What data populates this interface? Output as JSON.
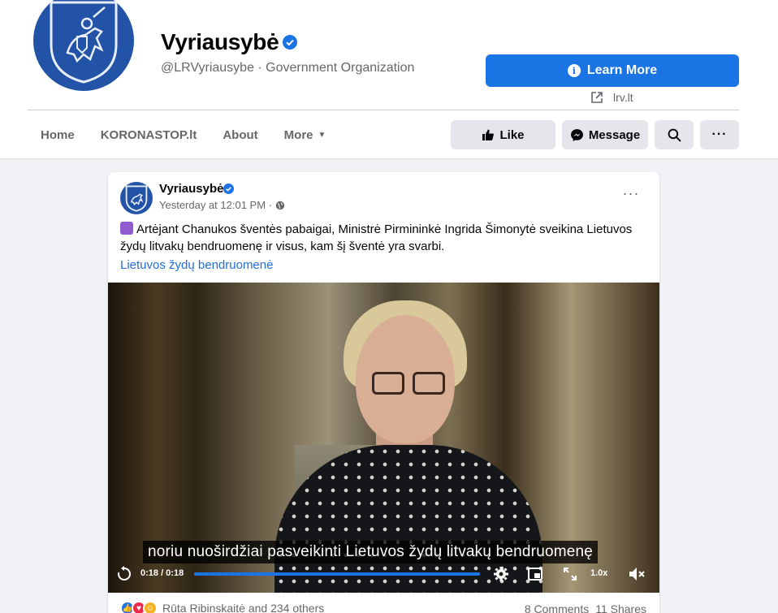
{
  "page": {
    "name": "Vyriausybė",
    "handle_line": "@LRVyriausybe · Government Organization",
    "cta_label": "Learn More",
    "external_link": "lrv.lt"
  },
  "nav": {
    "items": [
      {
        "label": "Home"
      },
      {
        "label": "KORONASTOP.lt"
      },
      {
        "label": "About"
      },
      {
        "label": "More"
      }
    ]
  },
  "actions": {
    "like_label": "Like",
    "message_label": "Message",
    "search_icon": "search-icon",
    "more_icon": "ellipsis-icon"
  },
  "post": {
    "author": "Vyriausybė",
    "timestamp": "Yesterday at 12:01 PM ·",
    "text": "Artėjant Chanukos šventės pabaigai, Ministrė Pirmininkė Ingrida Šimonytė sveikina Lietuvos žydų litvakų bendruomenę ir visus, kam šį šventė yra svarbi.",
    "tag_link": "Lietuvos žydų bendruomenė"
  },
  "video": {
    "subtitle": "noriu nuoširdžiai pasveikinti Lietuvos žydų litvakų bendruomenę",
    "time": "0:18 / 0:18",
    "progress": 1.0,
    "speed": "1.0x"
  },
  "stats": {
    "reactions_names": "Rūta Ribinskaitė and 234 others",
    "comments": "8 Comments",
    "shares": "11 Shares"
  },
  "colors": {
    "brand_blue": "#1b74e4",
    "emblem_blue": "#2353a6",
    "link_blue": "#216fdb"
  }
}
